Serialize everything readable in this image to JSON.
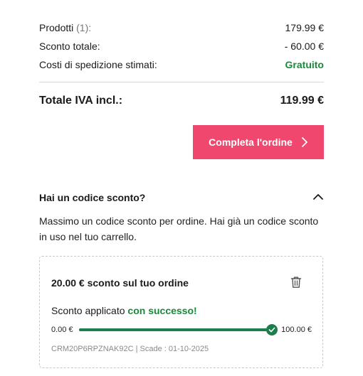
{
  "summary": {
    "products_label": "Prodotti",
    "products_count": "(1):",
    "products_value": "179.99 €",
    "discount_label": "Sconto totale:",
    "discount_value": "- 60.00 €",
    "shipping_label": "Costi di spedizione stimati:",
    "shipping_value": "Gratuito"
  },
  "total": {
    "label": "Totale IVA incl.:",
    "value": "119.99 €"
  },
  "checkout": {
    "label": "Completa l'ordine",
    "icon": "chevron-right-icon"
  },
  "coupon": {
    "title": "Hai un codice sconto?",
    "toggle_icon": "chevron-up-icon",
    "info": "Massimo un codice sconto per ordine. Hai già un codice sconto in uso nel tuo carrello.",
    "card": {
      "name": "20.00 € sconto sul tuo ordine",
      "delete_icon": "trash-icon",
      "applied_prefix": "Sconto applicato",
      "applied_status": "con successo!",
      "slider_min": "0.00 €",
      "slider_max": "100.00 €",
      "progress_fraction": 1.0,
      "meta": "CRM20P6RPZNAK92C | Scade : 01-10-2025"
    }
  },
  "colors": {
    "accent": "#f0476f",
    "success": "#1a8a3a",
    "slider": "#1a7f4b"
  }
}
